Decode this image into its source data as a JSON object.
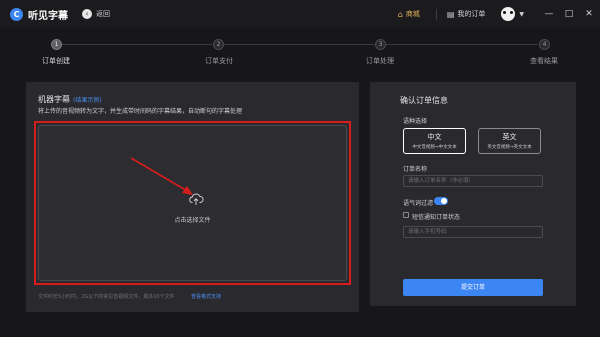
{
  "app": {
    "logo_glyph": "C",
    "name": "听见字幕",
    "back_label": "返回"
  },
  "header": {
    "mall_label": "商城",
    "orders_label": "我的订单",
    "minimize": "—",
    "maximize": "□",
    "close": "✕"
  },
  "steps": [
    {
      "num": "1",
      "label": "订单创建"
    },
    {
      "num": "2",
      "label": "订单支付"
    },
    {
      "num": "3",
      "label": "订单处理"
    },
    {
      "num": "4",
      "label": "查看结果"
    }
  ],
  "left": {
    "title": "机器字幕",
    "title_link": "(结果示例)",
    "subtitle": "将上传的音视频转为文字，并生成带时间码的字幕结果，自动断句的字幕处理",
    "upload_text": "点击选择文件",
    "footer": "文件时长5小时内，2G以下的常见音视频文件，最多10个文件",
    "footer_link": "查看格式支持"
  },
  "right": {
    "title": "确认订单信息",
    "language_label": "语种选择",
    "languages": [
      {
        "name": "中文",
        "desc": "中文音视频→中文文本"
      },
      {
        "name": "英文",
        "desc": "英文音视频→英文文本"
      }
    ],
    "order_name_label": "订单名称",
    "order_name_placeholder": "请输入订单名称（非必填）",
    "filler_label": "语气词过滤",
    "sms_label": "短信通知订单状态",
    "phone_placeholder": "请输入手机号码",
    "submit_label": "提交订单"
  },
  "colors": {
    "accent": "#3c86f4",
    "highlight_border": "#d51d1d",
    "mall": "#e3b35b"
  }
}
